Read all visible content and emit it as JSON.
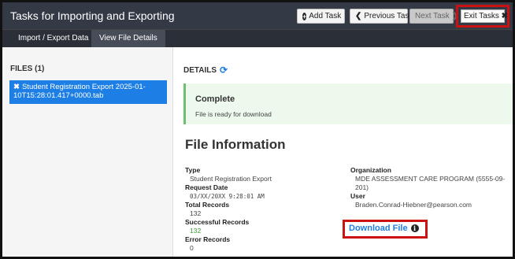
{
  "window": {
    "title": "Tasks for Importing and Exporting"
  },
  "toolbar": {
    "add_task": "Add Task",
    "previous_task": "Previous Task",
    "next_task": "Next Task",
    "exit_tasks": "Exit Tasks"
  },
  "tabs": [
    {
      "label": "Import / Export Data",
      "active": false
    },
    {
      "label": "View File Details",
      "active": true
    }
  ],
  "sidebar": {
    "heading": "FILES (1)",
    "files": [
      {
        "name": "Student Registration Export 2025-01-10T15:28:01.417+0000.tab",
        "selected": true
      }
    ]
  },
  "details": {
    "heading": "DETAILS",
    "status": {
      "title": "Complete",
      "message": "File is ready for download"
    },
    "info_heading": "File Information",
    "left": [
      {
        "label": "Type",
        "value": "Student Registration Export",
        "style": "normal"
      },
      {
        "label": "Request Date",
        "value": "03/XX/20XX 9:28:01 AM",
        "style": "mono"
      },
      {
        "label": "Total Records",
        "value": "132",
        "style": "normal"
      },
      {
        "label": "Successful Records",
        "value": "132",
        "style": "green"
      },
      {
        "label": "Error Records",
        "value": "0",
        "style": "normal"
      }
    ],
    "right": [
      {
        "label": "Organization",
        "value": "MDE ASSESSMENT CARE PROGRAM (5555-09-201)"
      },
      {
        "label": "User",
        "value": "Braden.Conrad-Hiebner@pearson.com"
      }
    ],
    "download_label": "Download File"
  },
  "colors": {
    "titlebar": "#333a45",
    "subnav": "#2a2f38",
    "accent": "#1d7fe6",
    "highlight_box": "#cc1111",
    "success_bg": "#eef9ee",
    "success_green": "#3a9a3a"
  }
}
